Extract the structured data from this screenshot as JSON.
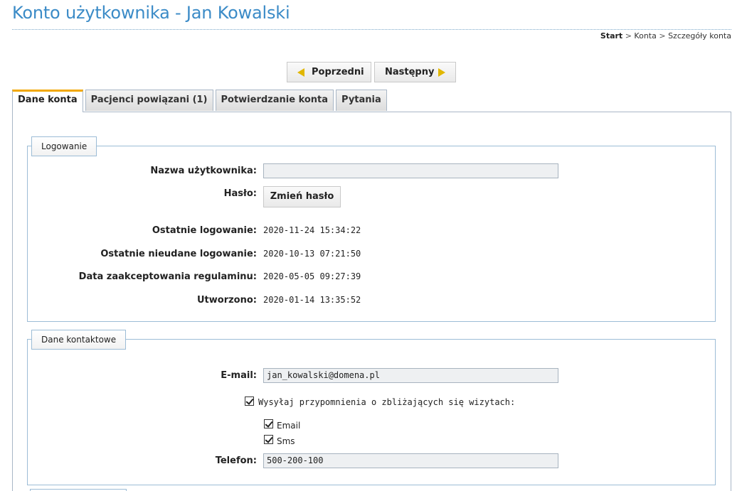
{
  "header": {
    "title": "Konto użytkownika - Jan Kowalski"
  },
  "breadcrumb": {
    "items": [
      "Start",
      "Konta",
      "Szczegóły konta"
    ],
    "separator": ">"
  },
  "pager": {
    "prev_label": "Poprzedni",
    "next_label": "Następny"
  },
  "tabs": [
    {
      "label": "Dane konta",
      "active": true
    },
    {
      "label": "Pacjenci powiązani (1)",
      "active": false
    },
    {
      "label": "Potwierdzanie konta",
      "active": false
    },
    {
      "label": "Pytania",
      "active": false
    }
  ],
  "login_section": {
    "legend": "Logowanie",
    "username_label": "Nazwa użytkownika:",
    "username_value": "",
    "password_label": "Hasło:",
    "change_password_label": "Zmień hasło",
    "last_login_label": "Ostatnie logowanie:",
    "last_login_value": "2020-11-24 15:34:22",
    "last_failed_label": "Ostatnie nieudane logowanie:",
    "last_failed_value": "2020-10-13 07:21:50",
    "terms_label": "Data zaakceptowania regulaminu:",
    "terms_value": "2020-05-05 09:27:39",
    "created_label": "Utworzono:",
    "created_value": "2020-01-14 13:35:52"
  },
  "contact_section": {
    "legend": "Dane kontaktowe",
    "email_label": "E-mail:",
    "email_value": "jan_kowalski@domena.pl",
    "reminders_label": "Wysyłaj przypomnienia o zbliżających się wizytach:",
    "reminders_checked": true,
    "reminder_email_label": "Email",
    "reminder_email_checked": true,
    "reminder_sms_label": "Sms",
    "reminder_sms_checked": true,
    "phone_label": "Telefon:",
    "phone_value": "500-200-100"
  },
  "colors": {
    "title": "#3b8bc7",
    "active_tab_accent": "#f2a800",
    "pager_arrow": "#e1b700",
    "border": "#9cbcd6"
  }
}
